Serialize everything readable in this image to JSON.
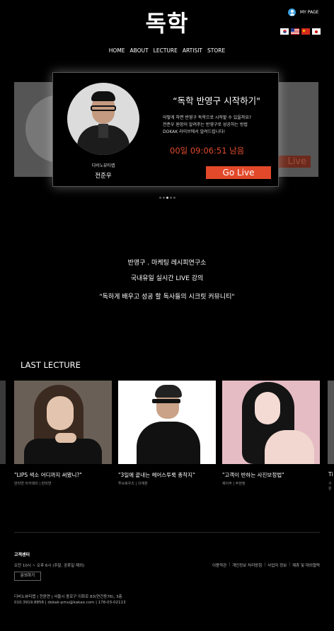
{
  "header": {
    "logo": "독학",
    "mypage_label": "MY PAGE",
    "flags": [
      "korea-flag-icon",
      "usa-flag-icon",
      "china-flag-icon",
      "japan-flag-icon"
    ]
  },
  "nav": [
    "HOME",
    "ABOUT",
    "LECTURE",
    "ARTISIT",
    "STORE"
  ],
  "banner": {
    "host_org": "디비노뷰티랩",
    "host_name": "전준우",
    "title": "“독학 반영구 시작하기\"",
    "desc": [
      "어떻게 하면 반영구 독학으로 시작할 수 있을까요?",
      "전준우 원장이 알려주는 반영구로 성공하는 방법",
      "DOKAK 라이브에서 알려드립니다!"
    ],
    "countdown": "00일 09:06:51 남음",
    "button_label": "Go Live",
    "side_button_label": "Live",
    "accent": "#e2492a",
    "dots_count": 5,
    "active_dot_index": 2
  },
  "intro": {
    "line1": "반영구 . 마케팅 레시피연구소",
    "line2": "국내유일 실시간 LIVE 강의",
    "line3": "\"독하게 배우고 성공 할 독사들의 시크릿 커뮤니티\""
  },
  "last_lecture": {
    "title": "LAST LECTURE",
    "items": [
      {
        "title": "\"LIPS 색소 어디까지 써봤니?\"",
        "sub": "반미연 아카데미 | 반미연"
      },
      {
        "title": "\"3일에 끝내는 헤어스투룩 총착지\"",
        "sub": "투브로우즈 | 이재훈"
      },
      {
        "title": "\"고객이 반하는 사진보정법\"",
        "sub": "제이주 | 주현정"
      }
    ],
    "peek_title": "Ti",
    "peek_sub": "구원"
  },
  "footer": {
    "title": "고객센터",
    "hours": "오전 10시 ~ 오후 6시 (주말, 공휴일 제외)",
    "inquiry_label": "문의하기",
    "links": [
      "이용약관",
      "개인정보 처리방침",
      "사업자 정보",
      "제휴 및 대외협력"
    ],
    "address_line1": "디비노뷰티랩 | 전윤연 | 서울시 종로구 이화로 83(연건동76), 3층",
    "address_line2": "010.3919.8858 | dokak-pmu@kakao.com | 178-03-02113"
  }
}
